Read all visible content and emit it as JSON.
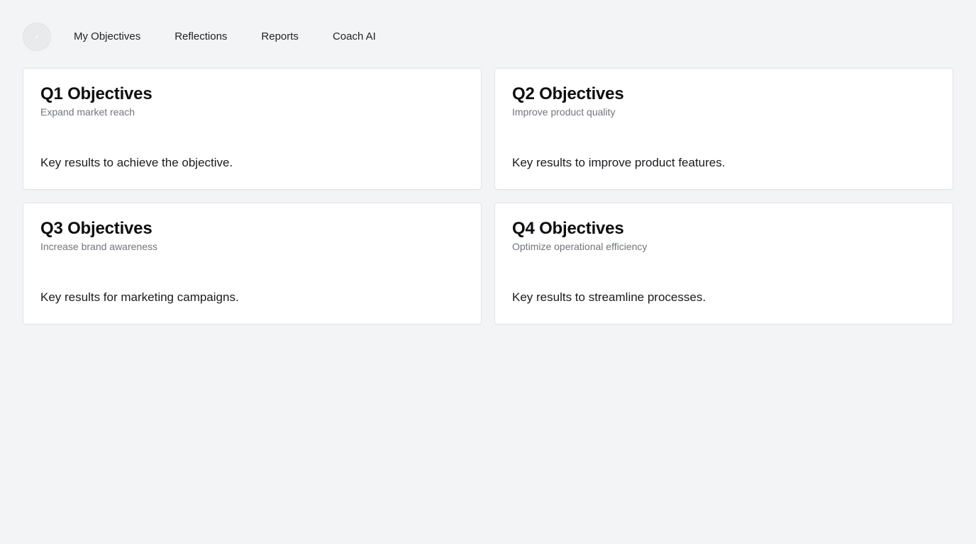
{
  "nav": {
    "items": [
      {
        "label": "My Objectives"
      },
      {
        "label": "Reflections"
      },
      {
        "label": "Reports"
      },
      {
        "label": "Coach AI"
      }
    ]
  },
  "cards": [
    {
      "title": "Q1 Objectives",
      "subtitle": "Expand market reach",
      "body": "Key results to achieve the objective."
    },
    {
      "title": "Q2 Objectives",
      "subtitle": "Improve product quality",
      "body": "Key results to improve product features."
    },
    {
      "title": "Q3 Objectives",
      "subtitle": "Increase brand awareness",
      "body": "Key results for marketing campaigns."
    },
    {
      "title": "Q4 Objectives",
      "subtitle": "Optimize operational efficiency",
      "body": "Key results to streamline processes."
    }
  ]
}
